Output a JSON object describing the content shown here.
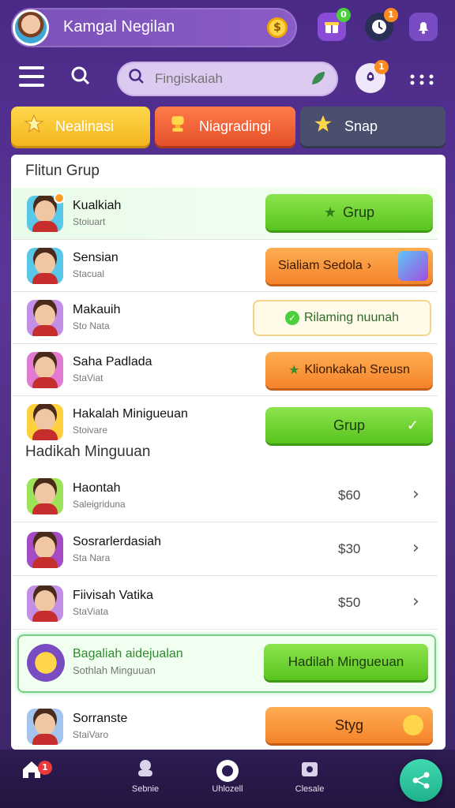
{
  "header": {
    "profile_name": "Kamgal Negilan",
    "coin_symbol": "$"
  },
  "top_icons": [
    {
      "icon": "gift-icon",
      "badge": "0",
      "color": "#8a4bd6",
      "badge_color": "#4ccf3c"
    },
    {
      "icon": "clock-icon",
      "badge": "1",
      "color": "#2a2f55",
      "badge_color": "#ff8a1f"
    },
    {
      "icon": "bell-icon",
      "badge": "",
      "color": "#7a4cc4",
      "badge_color": "#ff8a1f"
    }
  ],
  "search": {
    "placeholder": "Fingiskaiah"
  },
  "rocket_badge": "1",
  "tabs": [
    {
      "label": "Nealinasi",
      "icon": "star-icon"
    },
    {
      "label": "Niagradingi",
      "icon": "trophy-icon"
    },
    {
      "label": "Snap",
      "icon": "star-icon"
    }
  ],
  "sections": {
    "group_title": "Flitun Grup",
    "weekly_title": "Hadikah Minguuan"
  },
  "group_rows": [
    {
      "name": "Kualkiah",
      "sub": "Stoiuart",
      "action": "Grup",
      "action_style": "green",
      "avatar_color": "#59c7e8",
      "highlight": true
    },
    {
      "name": "Sensian",
      "sub": "Stacual",
      "action": "Sialiam Sedola",
      "action_style": "orange",
      "avatar_color": "#59c7e8"
    },
    {
      "name": "Makauih",
      "sub": "Sto Nata",
      "action": "Rilaming nuunah",
      "action_style": "outline",
      "avatar_color": "#c38fe6"
    },
    {
      "name": "Saha Padlada",
      "sub": "StaViat",
      "action": "Klionkakah Sreusn",
      "action_style": "orange",
      "avatar_color": "#e07bd1"
    },
    {
      "name": "Hakalah Minigueuan",
      "sub": "Stoivare",
      "action": "Grup",
      "action_style": "green",
      "avatar_color": "#ffcf3c"
    }
  ],
  "weekly_rows": [
    {
      "name": "Haontah",
      "sub": "Saleigriduna",
      "price": "$60",
      "avatar_color": "#9ce35a"
    },
    {
      "name": "Sosrarlerdasiah",
      "sub": "Sta Nara",
      "price": "$30",
      "avatar_color": "#a54cc4"
    },
    {
      "name": "Fiivisah Vatika",
      "sub": "StaViata",
      "price": "$50",
      "avatar_color": "#c38fe6"
    }
  ],
  "featured_row": {
    "name": "Bagaliah aidejualan",
    "sub": "Sothlah Minguuan",
    "action": "Hadilah Mingueuan"
  },
  "last_row": {
    "name": "Sorranste",
    "sub": "StaiVaro",
    "action": "Styg"
  },
  "bottom_nav": [
    {
      "label": "",
      "icon": "home-icon",
      "badge": "1"
    },
    {
      "label": "Sebnie",
      "icon": "group-icon"
    },
    {
      "label": "Uhlozell",
      "icon": "circle-icon"
    },
    {
      "label": "Clesale",
      "icon": "calendar-icon"
    }
  ],
  "colors": {
    "accent_green": "#58c41e",
    "accent_orange": "#f4832a",
    "accent_yellow": "#f3b51e",
    "background_purple": "#4a2a86"
  }
}
